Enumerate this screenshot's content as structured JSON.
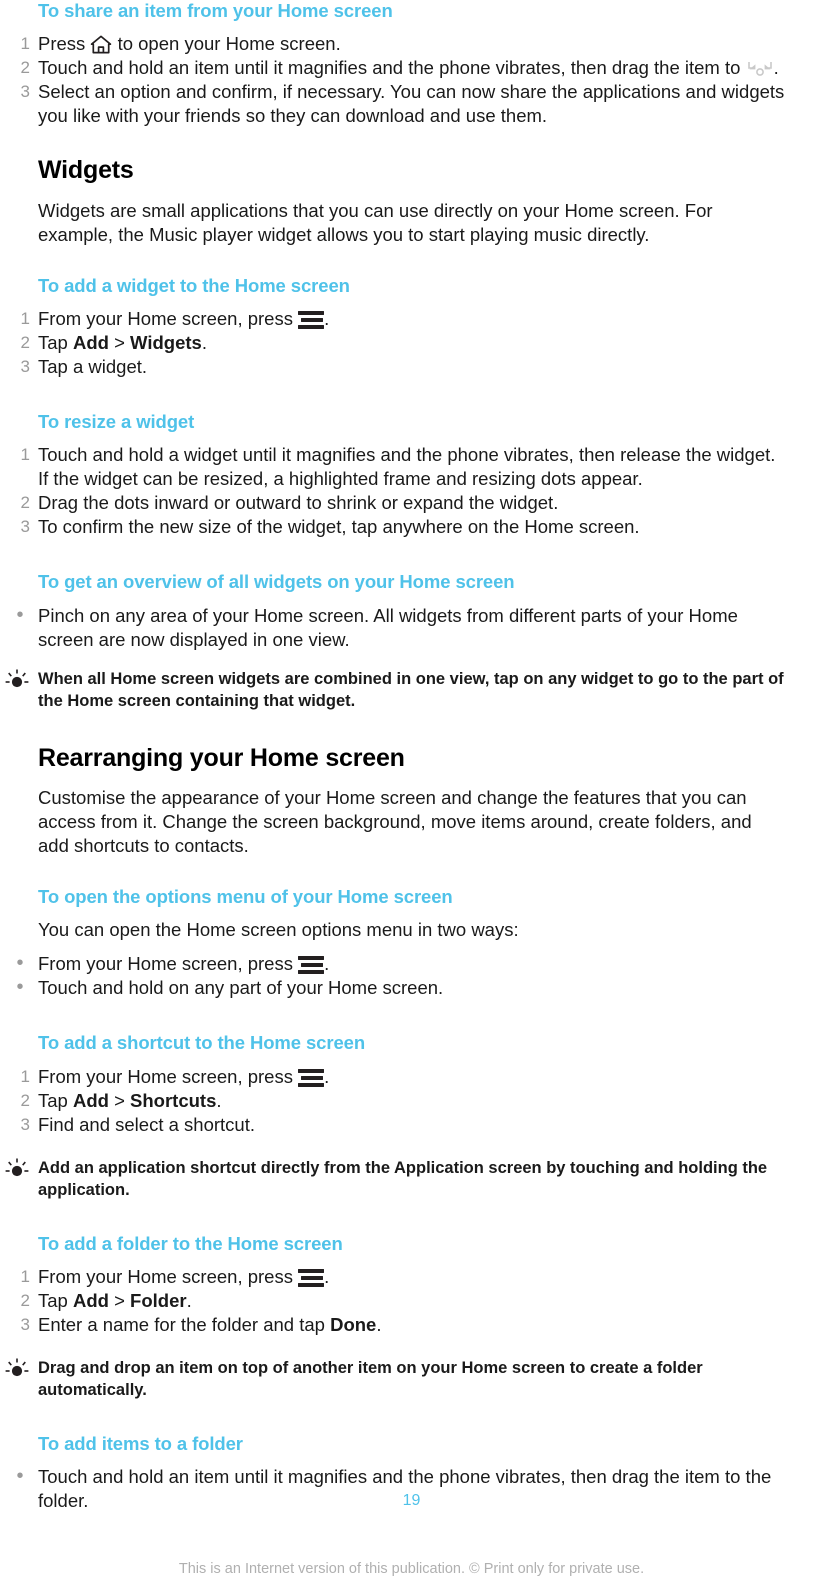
{
  "colors": {
    "heading_blue": "#4fc2e9",
    "body_text": "#1a1a1a",
    "marker_grey": "#9a9a9a",
    "footer_grey": "#b0b0b0"
  },
  "sections": {
    "share_item": {
      "heading": "To share an item from your Home screen",
      "steps": [
        {
          "num": "1",
          "pre": "Press ",
          "icon": "home-icon",
          "post": " to open your Home screen."
        },
        {
          "num": "2",
          "pre": "Touch and hold an item until it magnifies and the phone vibrates, then drag the item to ",
          "icon": "share-icon",
          "post": "."
        },
        {
          "num": "3",
          "pre": "Select an option and confirm, if necessary. You can now share the applications and widgets you like with your friends so they can download and use them.",
          "icon": "",
          "post": ""
        }
      ]
    },
    "widgets": {
      "title": "Widgets",
      "intro": "Widgets are small applications that you can use directly on your Home screen. For example, the Music player widget allows you to start playing music directly.",
      "add_widget": {
        "heading": "To add a widget to the Home screen",
        "steps": [
          {
            "num": "1",
            "pre": "From your Home screen, press ",
            "icon": "menu-icon",
            "post": "."
          },
          {
            "num": "2",
            "pre": "Tap ",
            "bold1": "Add",
            "sep": " > ",
            "bold2": "Widgets",
            "post": "."
          },
          {
            "num": "3",
            "pre": "Tap a widget.",
            "icon": "",
            "post": ""
          }
        ]
      },
      "resize_widget": {
        "heading": "To resize a widget",
        "steps": [
          {
            "num": "1",
            "text": "Touch and hold a widget until it magnifies and the phone vibrates, then release the widget. If the widget can be resized, a highlighted frame and resizing dots appear."
          },
          {
            "num": "2",
            "text": "Drag the dots inward or outward to shrink or expand the widget."
          },
          {
            "num": "3",
            "text": "To confirm the new size of the widget, tap anywhere on the Home screen."
          }
        ]
      },
      "overview_widgets": {
        "heading": "To get an overview of all widgets on your Home screen",
        "bullets": [
          {
            "text": "Pinch on any area of your Home screen. All widgets from different parts of your Home screen are now displayed in one view."
          }
        ],
        "tip": "When all Home screen widgets are combined in one view, tap on any widget to go to the part of the Home screen containing that widget."
      }
    },
    "rearranging": {
      "title": "Rearranging your Home screen",
      "intro": "Customise the appearance of your Home screen and change the features that you can access from it. Change the screen background, move items around, create folders, and add shortcuts to contacts.",
      "options_menu": {
        "heading": "To open the options menu of your Home screen",
        "intro": "You can open the Home screen options menu in two ways:",
        "bullets": [
          {
            "pre": "From your Home screen, press ",
            "icon": "menu-icon",
            "post": "."
          },
          {
            "pre": "Touch and hold on any part of your Home screen.",
            "icon": "",
            "post": ""
          }
        ]
      },
      "add_shortcut": {
        "heading": "To add a shortcut to the Home screen",
        "steps": [
          {
            "num": "1",
            "pre": "From your Home screen, press ",
            "icon": "menu-icon",
            "post": "."
          },
          {
            "num": "2",
            "pre": "Tap ",
            "bold1": "Add",
            "sep": " > ",
            "bold2": "Shortcuts",
            "post": "."
          },
          {
            "num": "3",
            "pre": "Find and select a shortcut.",
            "icon": "",
            "post": ""
          }
        ],
        "tip": "Add an application shortcut directly from the Application screen by touching and holding the application."
      },
      "add_folder": {
        "heading": "To add a folder to the Home screen",
        "steps": [
          {
            "num": "1",
            "pre": "From your Home screen, press ",
            "icon": "menu-icon",
            "post": "."
          },
          {
            "num": "2",
            "pre": "Tap ",
            "bold1": "Add",
            "sep": " > ",
            "bold2": "Folder",
            "post": "."
          },
          {
            "num": "3",
            "pre": "Enter a name for the folder and tap ",
            "bold1": "Done",
            "post": "."
          }
        ],
        "tip": "Drag and drop an item on top of another item on your Home screen to create a folder automatically."
      },
      "add_items_folder": {
        "heading": "To add items to a folder",
        "bullets": [
          {
            "text": "Touch and hold an item until it magnifies and the phone vibrates, then drag the item to the folder."
          }
        ]
      }
    }
  },
  "footer": {
    "page_number": "19",
    "note": "This is an Internet version of this publication. © Print only for private use."
  }
}
